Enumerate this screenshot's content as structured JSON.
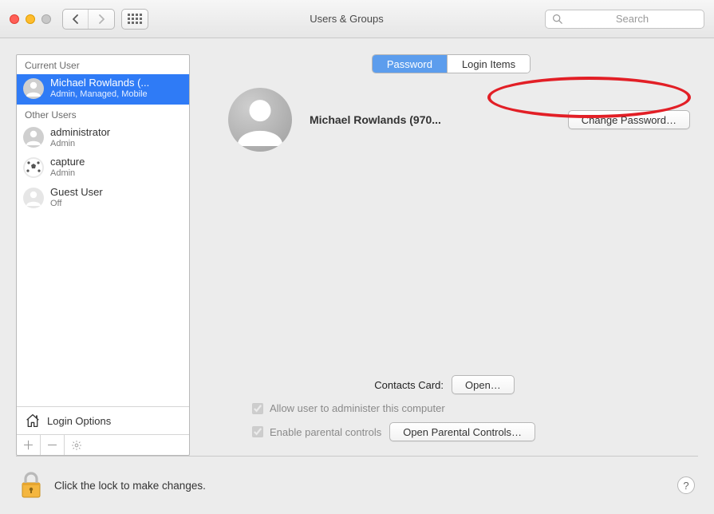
{
  "window": {
    "title": "Users & Groups"
  },
  "toolbar": {
    "search_placeholder": "Search"
  },
  "sidebar": {
    "current_header": "Current User",
    "other_header": "Other Users",
    "current": {
      "name": "Michael Rowlands (...",
      "role": "Admin, Managed, Mobile"
    },
    "others": [
      {
        "name": "administrator",
        "role": "Admin",
        "icon": "silhouette"
      },
      {
        "name": "capture",
        "role": "Admin",
        "icon": "soccer"
      },
      {
        "name": "Guest User",
        "role": "Off",
        "icon": "silhouette"
      }
    ],
    "login_options_label": "Login Options"
  },
  "tabs": [
    {
      "label": "Password",
      "active": true
    },
    {
      "label": "Login Items",
      "active": false
    }
  ],
  "profile": {
    "display_name": "Michael Rowlands (970...",
    "change_password_label": "Change Password…"
  },
  "contacts": {
    "label": "Contacts Card:",
    "open_label": "Open…"
  },
  "checkboxes": {
    "admin_label": "Allow user to administer this computer",
    "admin_checked": true,
    "parental_label": "Enable parental controls",
    "parental_checked": true,
    "parental_button": "Open Parental Controls…"
  },
  "footer": {
    "lock_text": "Click the lock to make changes."
  }
}
